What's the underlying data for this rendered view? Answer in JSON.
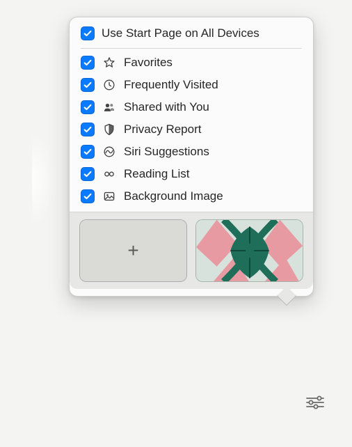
{
  "header": {
    "use_on_all_devices": "Use Start Page on All Devices"
  },
  "items": [
    {
      "label": "Favorites",
      "icon": "star-icon"
    },
    {
      "label": "Frequently Visited",
      "icon": "clock-icon"
    },
    {
      "label": "Shared with You",
      "icon": "people-icon"
    },
    {
      "label": "Privacy Report",
      "icon": "shield-icon"
    },
    {
      "label": "Siri Suggestions",
      "icon": "siri-icon"
    },
    {
      "label": "Reading List",
      "icon": "glasses-icon"
    },
    {
      "label": "Background Image",
      "icon": "image-icon"
    }
  ],
  "thumbs": {
    "add_label": "+",
    "wallpaper_name": "butterfly-wallpaper"
  },
  "colors": {
    "accent": "#0a7aff"
  }
}
